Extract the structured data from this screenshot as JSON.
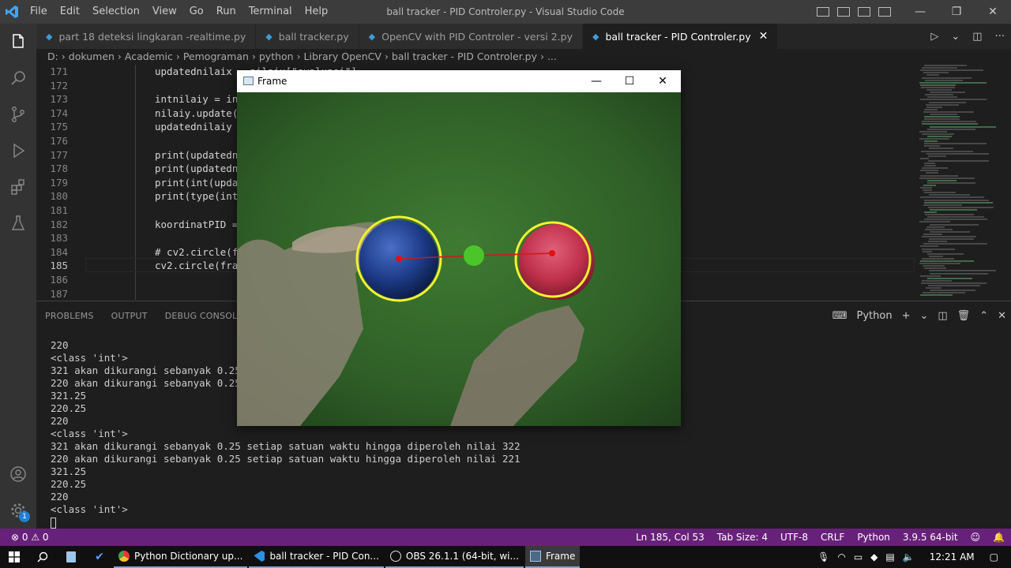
{
  "window": {
    "title": "ball tracker - PID Controler.py - Visual Studio Code"
  },
  "menu": [
    "File",
    "Edit",
    "Selection",
    "View",
    "Go",
    "Run",
    "Terminal",
    "Help"
  ],
  "tabs": [
    {
      "label": "part 18 deteksi lingkaran -realtime.py",
      "active": false
    },
    {
      "label": "ball tracker.py",
      "active": false
    },
    {
      "label": "OpenCV with PID Controler - versi 2.py",
      "active": false
    },
    {
      "label": "ball tracker - PID Controler.py",
      "active": true
    }
  ],
  "breadcrumb": "D: › dokumen › Academic › Pemograman › python › Library OpenCV › ball tracker - PID Controler.py › ...",
  "editor": {
    "lines": [
      {
        "n": "171",
        "text": "updatednilaix = nilaix[\"evaluasi\"]"
      },
      {
        "n": "172",
        "text": ""
      },
      {
        "n": "173",
        "text": "intnilaiy = int"
      },
      {
        "n": "174",
        "text": "nilaiy.update({"
      },
      {
        "n": "175",
        "text": "updatednilaiy ="
      },
      {
        "n": "176",
        "text": ""
      },
      {
        "n": "177",
        "text": "print(updatedni"
      },
      {
        "n": "178",
        "text": "print(updatedni"
      },
      {
        "n": "179",
        "text": "print(int(updat"
      },
      {
        "n": "180",
        "text": "print(type(int("
      },
      {
        "n": "181",
        "text": ""
      },
      {
        "n": "182",
        "text": "koordinatPID ="
      },
      {
        "n": "183",
        "text": ""
      },
      {
        "n": "184",
        "text": "# cv2.circle(fr"
      },
      {
        "n": "185",
        "text": "cv2.circle(fram"
      },
      {
        "n": "186",
        "text": ""
      },
      {
        "n": "187",
        "text": ""
      }
    ],
    "current_line": "185"
  },
  "panel": {
    "tabs": [
      "PROBLEMS",
      "OUTPUT",
      "DEBUG CONSOLE",
      "T"
    ],
    "shell": "Python",
    "terminal": [
      "220",
      "<class 'int'>",
      "321 akan dikurangi sebanyak 0.25 set",
      "220 akan dikurangi sebanyak 0.25 set",
      "321.25",
      "220.25",
      "220",
      "<class 'int'>",
      "321 akan dikurangi sebanyak 0.25 setiap satuan waktu hingga diperoleh nilai 322",
      "220 akan dikurangi sebanyak 0.25 setiap satuan waktu hingga diperoleh nilai 221",
      "321.25",
      "220.25",
      "220",
      "<class 'int'>"
    ]
  },
  "statusbar": {
    "errors": "⊗ 0 ⚠ 0",
    "position": "Ln 185, Col 53",
    "tab_size": "Tab Size: 4",
    "encoding": "UTF-8",
    "eol": "CRLF",
    "language": "Python",
    "interpreter": "3.9.5 64-bit"
  },
  "frame_window": {
    "title": "Frame"
  },
  "taskbar": {
    "apps": [
      {
        "label": "Python Dictionary up...",
        "icon": "chrome-icon",
        "active": false
      },
      {
        "label": "ball tracker - PID Con...",
        "icon": "vscode-icon",
        "active": false
      },
      {
        "label": "OBS 26.1.1 (64-bit, wi...",
        "icon": "obs-icon",
        "active": false
      },
      {
        "label": "Frame",
        "icon": "frame-app-icon",
        "active": true
      }
    ],
    "clock": "12:21 AM"
  },
  "colors": {
    "statusbar": "#68217a",
    "accent_blue": "#3ea6ff",
    "ball_blue": "#1f3d8a",
    "ball_red": "#c0304a",
    "circle_yellow": "#f2f230",
    "target_green": "#4cc52a"
  }
}
